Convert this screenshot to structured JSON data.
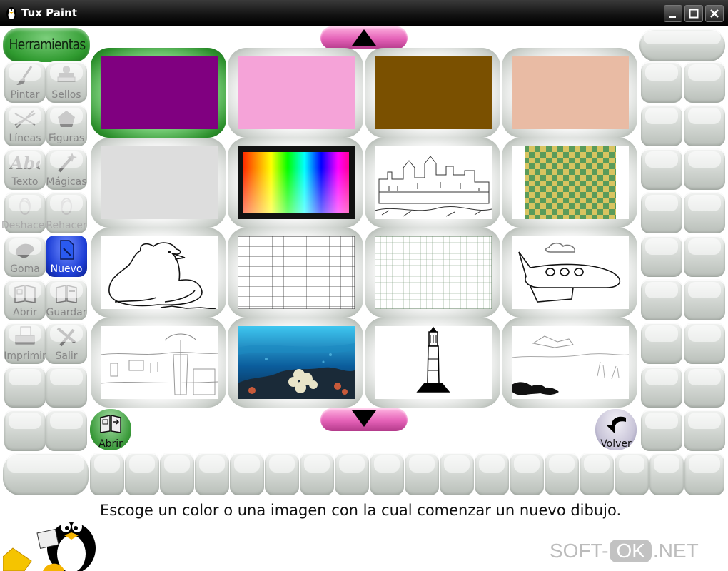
{
  "window": {
    "title": "Tux Paint"
  },
  "toolbar": {
    "header": "Herramientas",
    "tools": [
      {
        "label": "Pintar",
        "icon": "paintbrush-icon"
      },
      {
        "label": "Sellos",
        "icon": "stamp-icon"
      },
      {
        "label": "Líneas",
        "icon": "lines-icon"
      },
      {
        "label": "Figuras",
        "icon": "shapes-icon"
      },
      {
        "label": "Texto",
        "icon": "text-icon"
      },
      {
        "label": "Mágicas",
        "icon": "magic-wand-icon"
      },
      {
        "label": "Deshacer",
        "icon": "undo-icon"
      },
      {
        "label": "Rehacer",
        "icon": "redo-icon"
      },
      {
        "label": "Goma",
        "icon": "eraser-icon"
      },
      {
        "label": "Nuevo",
        "icon": "new-document-icon"
      },
      {
        "label": "Abrir",
        "icon": "open-book-icon"
      },
      {
        "label": "Guardar",
        "icon": "save-book-icon"
      },
      {
        "label": "Imprimir",
        "icon": "printer-icon"
      },
      {
        "label": "Salir",
        "icon": "exit-icon"
      }
    ]
  },
  "colors": {
    "purple": "#800080",
    "pink": "#f5a3d8",
    "brown": "#7a5000",
    "peach": "#e9bba4",
    "light_gray": "#dddddd",
    "selected_ring": "#2c8f2c",
    "active_tool": "#1e3fd6",
    "scroll_pink": "#e461b7"
  },
  "dialog": {
    "open_label": "Abrir",
    "back_label": "Volver",
    "instruction": "Escoge un color o una imagen con la cual comenzar un nuevo dibujo."
  },
  "watermark": {
    "left": "SOFT-",
    "ok": "OK",
    "right": ".NET"
  }
}
